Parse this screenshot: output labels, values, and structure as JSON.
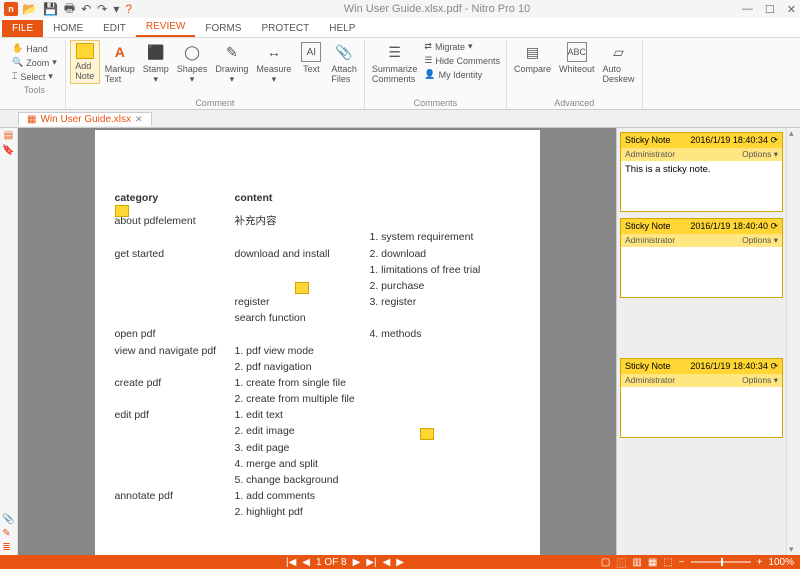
{
  "titlebar": {
    "title": "Win User Guide.xlsx.pdf - Nitro Pro 10"
  },
  "tabs": {
    "file": "FILE",
    "home": "HOME",
    "edit": "EDIT",
    "review": "REVIEW",
    "forms": "FORMS",
    "protect": "PROTECT",
    "help": "HELP"
  },
  "ribbon": {
    "tools": {
      "hand": "Hand",
      "zoom": "Zoom",
      "select": "Select",
      "label": "Tools"
    },
    "comment": {
      "add_note": "Add\nNote",
      "markup": "Markup\nText",
      "stamp": "Stamp",
      "shapes": "Shapes",
      "drawing": "Drawing",
      "measure": "Measure",
      "text": "Text",
      "attach": "Attach\nFiles",
      "label": "Comment"
    },
    "comments": {
      "summarize": "Summarize\nComments",
      "migrate": "Migrate",
      "hide": "Hide Comments",
      "identity": "My Identity",
      "label": "Comments"
    },
    "advanced": {
      "compare": "Compare",
      "whiteout": "Whiteout",
      "deskew": "Auto\nDeskew",
      "label": "Advanced"
    }
  },
  "doc_tab": {
    "name": "Win User Guide.xlsx"
  },
  "page": {
    "headers": {
      "category": "category",
      "content": "content"
    },
    "rows": [
      {
        "cat": "about pdfelement",
        "c1": "补充内容",
        "c2": ""
      },
      {
        "cat": "",
        "c1": "",
        "c2": "1. system requirement"
      },
      {
        "cat": "get started",
        "c1": "download and install",
        "c2": "2. download"
      },
      {
        "cat": "",
        "c1": "",
        "c2": "1. limitations of free trial"
      },
      {
        "cat": "",
        "c1": "",
        "c2": "2. purchase"
      },
      {
        "cat": "",
        "c1": "register",
        "c2": "3. register"
      },
      {
        "cat": "",
        "c1": "search function",
        "c2": ""
      },
      {
        "cat": "open pdf",
        "c1": "",
        "c2": "4. methods"
      },
      {
        "cat": "view and navigate pdf",
        "c1": "1. pdf view mode",
        "c2": ""
      },
      {
        "cat": "",
        "c1": "2. pdf navigation",
        "c2": ""
      },
      {
        "cat": "create pdf",
        "c1": "1. create from single file",
        "c2": ""
      },
      {
        "cat": "",
        "c1": "2. create from multiple file",
        "c2": ""
      },
      {
        "cat": "edit pdf",
        "c1": "1. edit text",
        "c2": ""
      },
      {
        "cat": "",
        "c1": "2. edit image",
        "c2": ""
      },
      {
        "cat": "",
        "c1": "3. edit page",
        "c2": ""
      },
      {
        "cat": "",
        "c1": "4. merge and split",
        "c2": ""
      },
      {
        "cat": "",
        "c1": "5. change background",
        "c2": ""
      },
      {
        "cat": "annotate pdf",
        "c1": "1. add comments",
        "c2": ""
      },
      {
        "cat": "",
        "c1": "2. highlight pdf",
        "c2": ""
      }
    ]
  },
  "notes": [
    {
      "title": "Sticky Note",
      "time": "2016/1/19 18:40:34",
      "author": "Administrator",
      "opts": "Options",
      "body": "This is a sticky note."
    },
    {
      "title": "Sticky Note",
      "time": "2016/1/19 18:40:40",
      "author": "Administrator",
      "opts": "Options",
      "body": ""
    },
    {
      "title": "Sticky Note",
      "time": "2016/1/19 18:40:34",
      "author": "Administrator",
      "opts": "Options",
      "body": ""
    }
  ],
  "status": {
    "page": "1 OF 8",
    "zoom": "100%"
  }
}
